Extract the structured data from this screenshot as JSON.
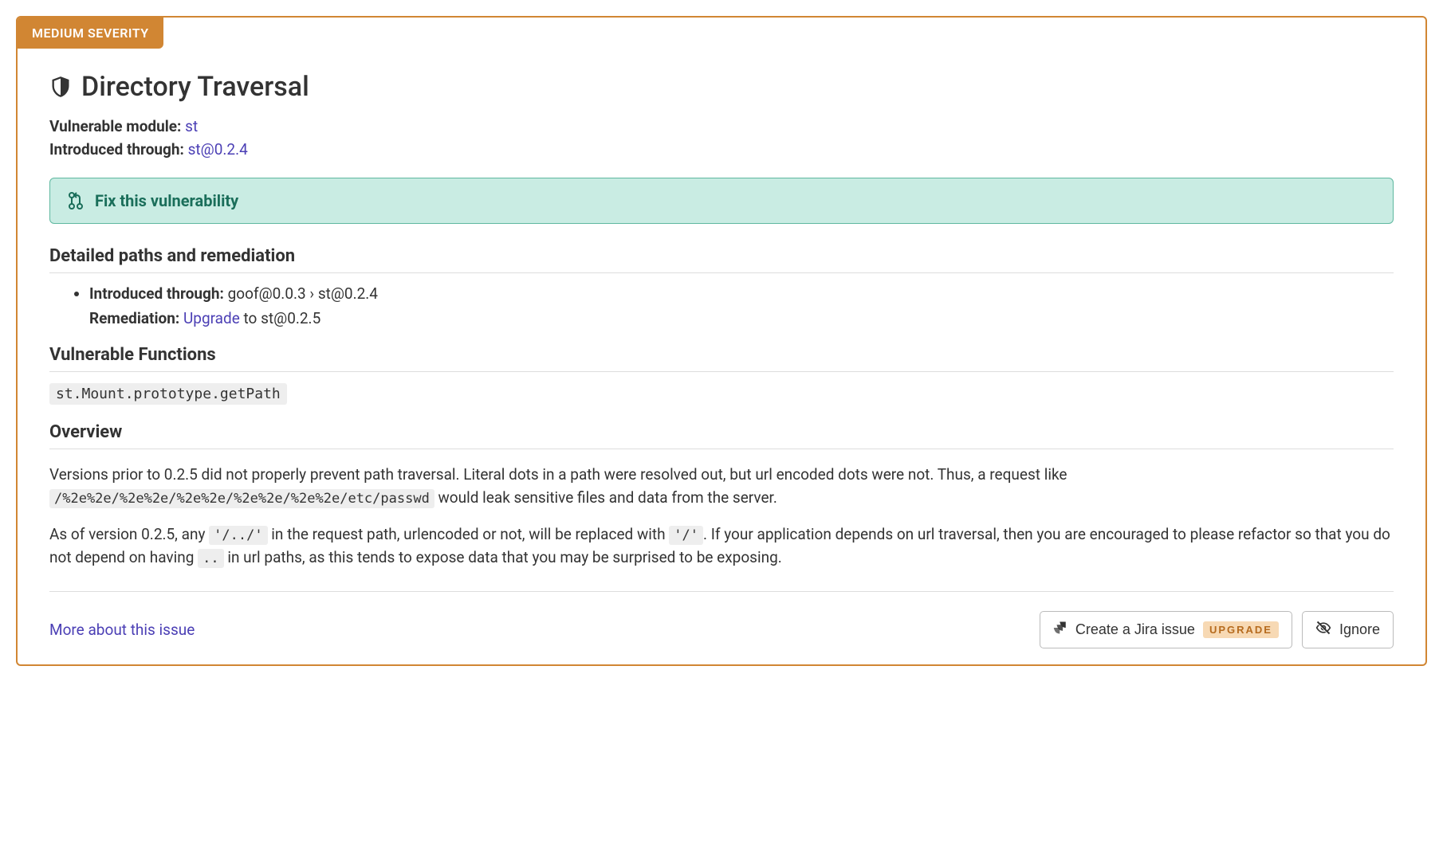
{
  "severity": {
    "label": "MEDIUM SEVERITY"
  },
  "title": "Directory Traversal",
  "meta": {
    "vulnerable_module_label": "Vulnerable module:",
    "vulnerable_module_value": "st",
    "introduced_through_label": "Introduced through:",
    "introduced_through_value": "st@0.2.4"
  },
  "fix": {
    "label": "Fix this vulnerability"
  },
  "sections": {
    "detailed_paths": "Detailed paths and remediation",
    "vulnerable_functions": "Vulnerable Functions",
    "overview": "Overview"
  },
  "path": {
    "introduced_label": "Introduced through:",
    "introduced_value": "goof@0.0.3 › st@0.2.4",
    "remediation_label": "Remediation:",
    "remediation_action": "Upgrade",
    "remediation_target": " to st@0.2.5"
  },
  "vulnerable_function": "st.Mount.prototype.getPath",
  "overview": {
    "p1_a": "Versions prior to 0.2.5 did not properly prevent path traversal. Literal dots in a path were resolved out, but url encoded dots were not. Thus, a request like ",
    "p1_code": "/%2e%2e/%2e%2e/%2e%2e/%2e%2e/%2e%2e/etc/passwd",
    "p1_b": " would leak sensitive files and data from the server.",
    "p2_a": "As of version 0.2.5, any ",
    "p2_code1": "'/../'",
    "p2_b": " in the request path, urlencoded or not, will be replaced with ",
    "p2_code2": "'/'",
    "p2_c": ". If your application depends on url traversal, then you are encouraged to please refactor so that you do not depend on having ",
    "p2_code3": "..",
    "p2_d": " in url paths, as this tends to expose data that you may be surprised to be exposing."
  },
  "footer": {
    "more": "More about this issue",
    "jira": "Create a Jira issue",
    "upgrade_pill": "UPGRADE",
    "ignore": "Ignore"
  }
}
